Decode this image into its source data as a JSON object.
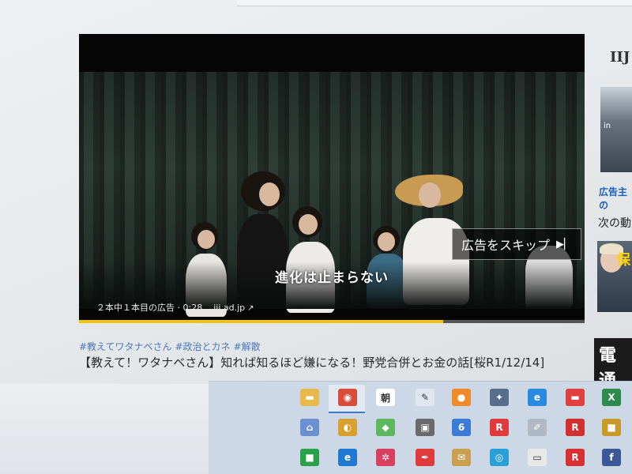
{
  "player": {
    "subtitle": "進化は止まらない",
    "skip_label": "広告をスキップ",
    "skip_icon": "skip-next-icon",
    "ad_counter": "２本中１本目の広告 · 0:28",
    "ad_domain": "iij.ad.jp",
    "progress_fraction": 0.72,
    "progress_color": "#f1c400"
  },
  "video": {
    "hashtags": [
      "#教えてワタナベさん",
      "#政治とカネ",
      "#解散"
    ],
    "title": "【教えて！ワタナベさん】知れば知るほど嫌になる！野党合併とお金の話[桜R1/12/14]"
  },
  "sidebar": {
    "logo": "IIJ",
    "ad_label": "広告主の",
    "next_label": "次の動",
    "thumb1_text": "in",
    "thumb2_text": "保",
    "thumb3_text": "電通"
  },
  "taskbar": {
    "tiles": [
      {
        "icon": "folder-icon",
        "glyph": "▬",
        "color": "#e8b84a"
      },
      {
        "icon": "chrome-icon",
        "glyph": "◉",
        "color": "#d94b3b"
      },
      {
        "icon": "asahi-icon",
        "glyph": "朝",
        "color": "#ffffff"
      },
      {
        "icon": "paint-icon",
        "glyph": "✎",
        "color": "#e0e6ef"
      },
      {
        "icon": "media-icon",
        "glyph": "●",
        "color": "#f08a2a"
      },
      {
        "icon": "tool-icon",
        "glyph": "✦",
        "color": "#586d8c"
      },
      {
        "icon": "ie-icon",
        "glyph": "e",
        "color": "#2a8ae0"
      },
      {
        "icon": "red-app-icon",
        "glyph": "▬",
        "color": "#e04040"
      },
      {
        "icon": "excel-icon",
        "glyph": "X",
        "color": "#2c8b4a"
      },
      {
        "icon": "home-icon",
        "glyph": "⌂",
        "color": "#6b8fd0"
      },
      {
        "icon": "globe-icon",
        "glyph": "◐",
        "color": "#d8a030"
      },
      {
        "icon": "evernote-icon",
        "glyph": "◆",
        "color": "#5cb85c"
      },
      {
        "icon": "scanner-icon",
        "glyph": "▣",
        "color": "#6a6a6a"
      },
      {
        "icon": "calendar-icon",
        "glyph": "6",
        "color": "#3a7bd5"
      },
      {
        "icon": "r-app-icon",
        "glyph": "R",
        "color": "#e03a3a"
      },
      {
        "icon": "brush-icon",
        "glyph": "✐",
        "color": "#b0b8c4"
      },
      {
        "icon": "r-app2-icon",
        "glyph": "R",
        "color": "#d23030"
      },
      {
        "icon": "bag-icon",
        "glyph": "■",
        "color": "#c99a2a"
      },
      {
        "icon": "green-app-icon",
        "glyph": "■",
        "color": "#2aa24a"
      },
      {
        "icon": "edge-icon",
        "glyph": "e",
        "color": "#1f78d1"
      },
      {
        "icon": "snow-icon",
        "glyph": "✲",
        "color": "#d84060"
      },
      {
        "icon": "pen-icon",
        "glyph": "✒",
        "color": "#e03a3a"
      },
      {
        "icon": "mail-icon",
        "glyph": "✉",
        "color": "#c8a050"
      },
      {
        "icon": "search-app-icon",
        "glyph": "◎",
        "color": "#2a9fd8"
      },
      {
        "icon": "document-icon",
        "glyph": "▭",
        "color": "#e8e8e8"
      },
      {
        "icon": "r-app3-icon",
        "glyph": "R",
        "color": "#d83030"
      },
      {
        "icon": "facebook-icon",
        "glyph": "f",
        "color": "#3b5998"
      }
    ]
  }
}
